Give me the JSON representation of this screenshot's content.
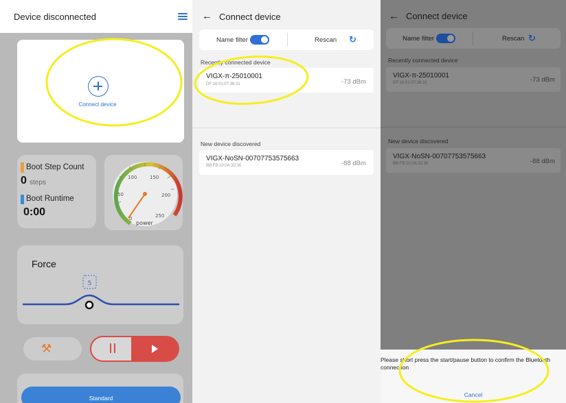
{
  "panel_home": {
    "header_title": "Device disconnected",
    "connect_label": "Connect device",
    "step_count_label": "Boot Step Count",
    "step_count_value": "0",
    "step_count_unit": "steps",
    "runtime_label": "Boot Runtime",
    "runtime_value": "0:00",
    "gauge": {
      "ticks": [
        "0",
        "50",
        "100",
        "150",
        "200",
        "250"
      ],
      "label": "power",
      "value": 0
    },
    "force_title": "Force",
    "force_value": "5",
    "standard_label": "Standard"
  },
  "panel_scan": {
    "header_title": "Connect device",
    "name_filter_label": "Name filter",
    "name_filter_on": true,
    "rescan_label": "Rescan",
    "recent_section_label": "Recently connected device",
    "recent_devices": [
      {
        "name": "VIGX-π-25010001",
        "mac": "DF:16:01:07:38:31",
        "rssi": "-73 dBm"
      }
    ],
    "new_section_label": "New device discovered",
    "new_devices": [
      {
        "name": "VIGX-NoSN-00707753575663",
        "mac": "BB:FB:10:0A:32:30",
        "rssi": "-88 dBm"
      }
    ]
  },
  "panel_confirm": {
    "header_title": "Connect device",
    "name_filter_label": "Name filter",
    "rescan_label": "Rescan",
    "recent_section_label": "Recently connected device",
    "recent_devices": [
      {
        "name": "VIGX-π-25010001",
        "mac": "DF:16:01:07:38:31",
        "rssi": "-73 dBm"
      }
    ],
    "new_section_label": "New device discovered",
    "new_devices": [
      {
        "name": "VIGX-NoSN-00707753575663",
        "mac": "BB:FB:10:0A:32:30",
        "rssi": "-88 dBm"
      }
    ],
    "sheet_message": "Please short press the start/pause button to confirm the Bluetooth connection",
    "cancel_label": "Cancel"
  },
  "colors": {
    "accent_blue": "#2e6fd8",
    "annotation_yellow": "#f5ee1e",
    "pause_red": "#d84c47",
    "tools_orange": "#e37a2c",
    "overlay_grey": "#7f7f7f"
  }
}
